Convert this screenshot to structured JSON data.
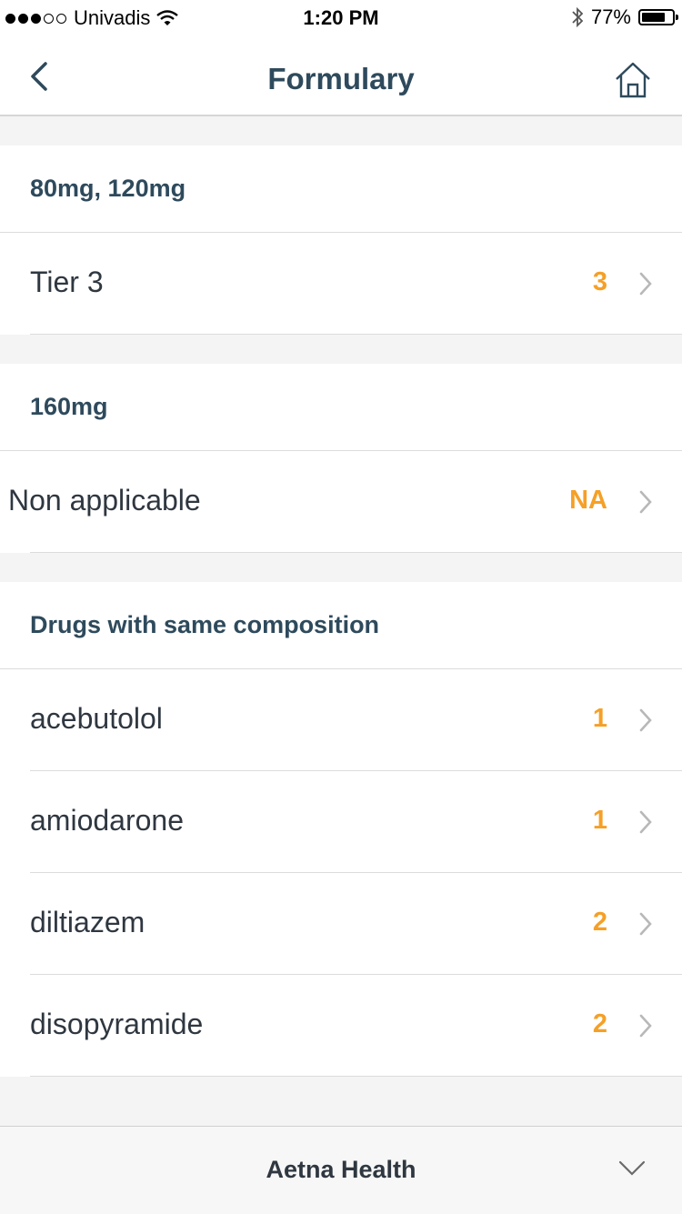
{
  "status_bar": {
    "carrier": "Univadis",
    "time": "1:20 PM",
    "battery": "77%",
    "battery_level": 0.77
  },
  "nav": {
    "title": "Formulary"
  },
  "sections": [
    {
      "header": "80mg, 120mg",
      "rows": [
        {
          "label": "Tier 3",
          "value": "3"
        }
      ]
    },
    {
      "header": "160mg",
      "rows": [
        {
          "label": "Non applicable",
          "value": "NA"
        }
      ]
    },
    {
      "header": "Drugs with same composition",
      "rows": [
        {
          "label": "acebutolol",
          "value": "1"
        },
        {
          "label": "amiodarone",
          "value": "1"
        },
        {
          "label": "diltiazem",
          "value": "2"
        },
        {
          "label": "disopyramide",
          "value": "2"
        }
      ]
    }
  ],
  "bottom_bar": {
    "title": "Aetna Health"
  },
  "colors": {
    "accent": "#f5a027",
    "header_text": "#2e4a5c",
    "background": "#f4f4f4"
  }
}
